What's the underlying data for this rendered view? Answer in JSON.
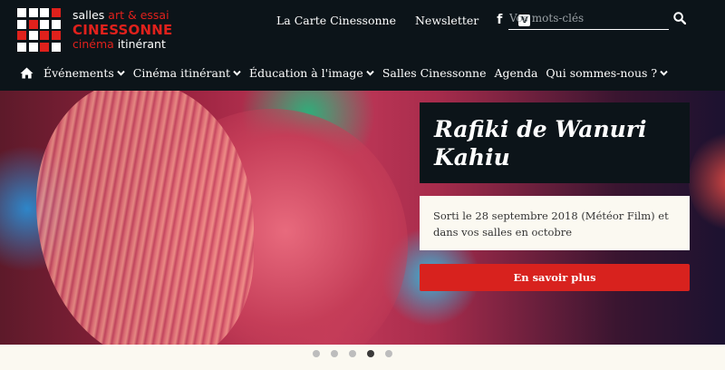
{
  "logo": {
    "line1_plain": "salles ",
    "line1_accent": "art & essai",
    "brand": "CINESSONNE",
    "line3_accent": "cinéma",
    "line3_plain": " itinérant",
    "grid_pattern": [
      "w",
      "w",
      "w",
      "r",
      "w",
      "r",
      "w",
      "w",
      "r",
      "w",
      "r",
      "r",
      "w",
      "w",
      "r",
      "w"
    ]
  },
  "header": {
    "links": {
      "carte": "La Carte Cinessonne",
      "newsletter": "Newsletter"
    },
    "social": {
      "facebook": "f",
      "vimeo": "V"
    },
    "search": {
      "placeholder": "Vos mots-clés",
      "icon": "search-icon"
    }
  },
  "nav": {
    "home_icon": "home-icon",
    "items": [
      {
        "label": "Événements",
        "has_dropdown": true
      },
      {
        "label": "Cinéma itinérant",
        "has_dropdown": true
      },
      {
        "label": "Éducation à l'image",
        "has_dropdown": true
      },
      {
        "label": "Salles Cinessonne",
        "has_dropdown": false
      },
      {
        "label": "Agenda",
        "has_dropdown": false
      },
      {
        "label": "Qui sommes-nous ?",
        "has_dropdown": true
      }
    ]
  },
  "hero": {
    "title": "Rafiki de Wanuri Kahiu",
    "description": "Sorti le 28 septembre 2018 (Météor Film) et dans vos salles en octobre",
    "button_label": "En savoir plus",
    "slides_total": 5,
    "active_slide": 4
  },
  "colors": {
    "header_bg": "#0c1419",
    "accent": "#d8221e",
    "page_bg": "#fbf9f1"
  }
}
